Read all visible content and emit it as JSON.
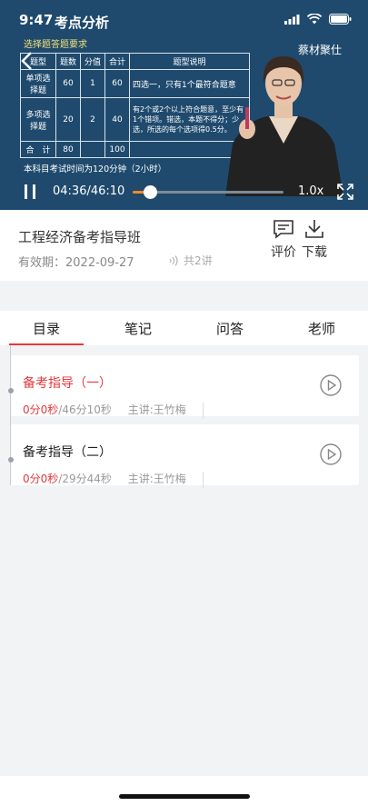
{
  "status": {
    "time": "9:47"
  },
  "video": {
    "title": "考点分析",
    "slide": {
      "heading": "选择题答题要求",
      "table_headers": [
        "题型",
        "题数",
        "分值",
        "合计",
        "题型说明"
      ],
      "rows": [
        {
          "type": "单项选择题",
          "count": "60",
          "score": "1",
          "total": "60",
          "desc": "四选一，只有1个最符合题意"
        },
        {
          "type": "多项选择题",
          "count": "20",
          "score": "2",
          "total": "40",
          "desc": "有2个或2个以上符合题意，至少有1个错项。错选，本题不得分；少选，所选的每个选项得0.5分。"
        },
        {
          "type": "合　计",
          "count": "80",
          "score": "",
          "total": "100",
          "desc": ""
        }
      ],
      "footer": "本科目考试时间为120分钟（2小时）",
      "logo": "蔡材聚仕"
    },
    "current_time": "04:36/46:10",
    "progress": 0.1,
    "speed": "1.0x"
  },
  "course": {
    "title": "工程经济备考指导班",
    "valid": "有效期：2022-09-27",
    "lessons": "共2讲",
    "actions": {
      "review": "评价",
      "download": "下载"
    }
  },
  "tabs": [
    "目录",
    "笔记",
    "问答",
    "老师"
  ],
  "items": [
    {
      "title": "备考指导（一）",
      "progress": "0分0秒",
      "duration": "/46分10秒",
      "teacher": "主讲:王竹梅"
    },
    {
      "title": "备考指导（二）",
      "progress": "0分0秒",
      "duration": "/29分44秒",
      "teacher": "主讲:王竹梅"
    }
  ],
  "colors": {
    "accent": "#e4393c",
    "video_bg": "#1f4a6d",
    "progress": "#f08a24"
  }
}
